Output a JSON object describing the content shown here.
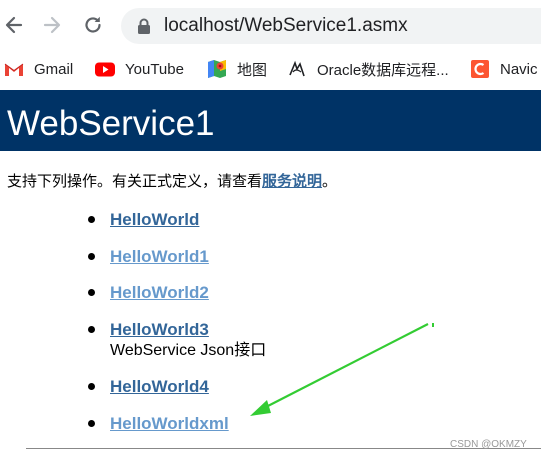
{
  "browser": {
    "url_host": "localhost",
    "url_path": "/WebService1.asmx",
    "bookmarks": [
      {
        "label": "Gmail",
        "icon": "gmail-icon"
      },
      {
        "label": "YouTube",
        "icon": "youtube-icon"
      },
      {
        "label": "地图",
        "icon": "maps-icon"
      },
      {
        "label": "Oracle数据库远程...",
        "icon": "oracle-icon"
      },
      {
        "label": "Navic",
        "icon": "navicat-icon"
      }
    ]
  },
  "page": {
    "title": "WebService1",
    "intro_text": "支持下列操作。有关正式定义，请查看",
    "intro_link": "服务说明",
    "intro_end": "。",
    "operations": [
      {
        "name": "HelloWorld",
        "description": ""
      },
      {
        "name": "HelloWorld1",
        "description": ""
      },
      {
        "name": "HelloWorld2",
        "description": ""
      },
      {
        "name": "HelloWorld3",
        "description": "WebService Json接口"
      },
      {
        "name": "HelloWorld4",
        "description": ""
      },
      {
        "name": "HelloWorldxml",
        "description": ""
      }
    ],
    "watermark": "CSDN @OKMZY"
  },
  "colors": {
    "header_bg": "#003366",
    "link": "#336699",
    "visited_link": "#6699cc",
    "arrow": "#33cc33"
  }
}
